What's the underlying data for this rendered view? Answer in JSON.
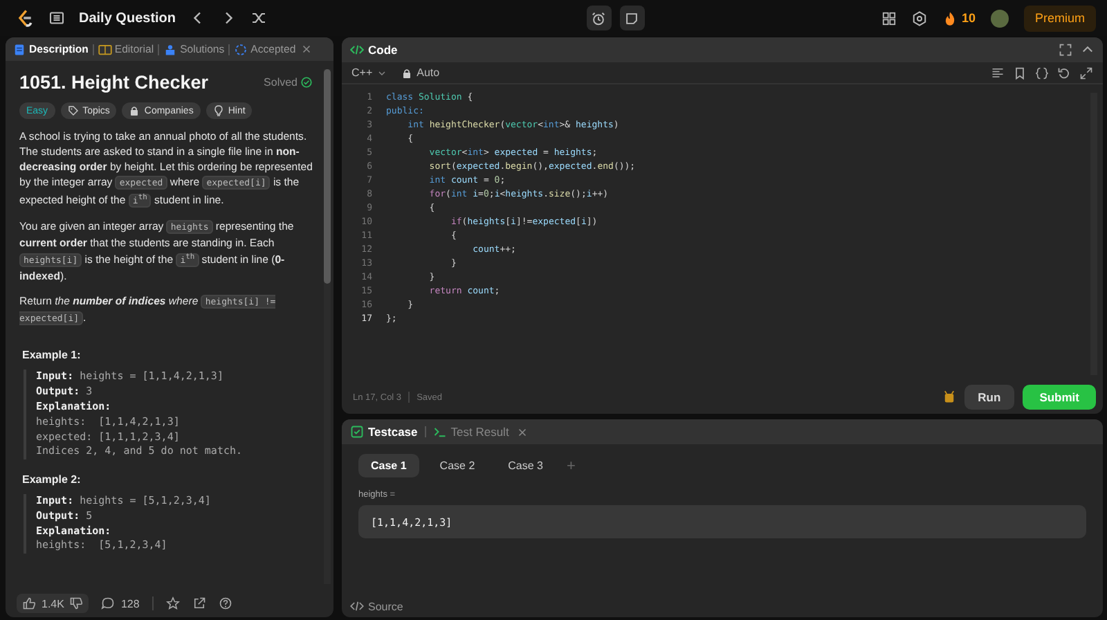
{
  "top_bar": {
    "title": "Daily Question",
    "streak": "10",
    "premium": "Premium"
  },
  "description_panel": {
    "tabs": [
      {
        "label": "Description",
        "selected": true,
        "closable": false
      },
      {
        "label": "Editorial",
        "selected": false,
        "closable": false
      },
      {
        "label": "Solutions",
        "selected": false,
        "closable": false
      },
      {
        "label": "Accepted",
        "selected": false,
        "closable": true
      }
    ],
    "title": "1051. Height Checker",
    "status": "Solved",
    "solved": true,
    "tags": [
      {
        "label": "Easy",
        "kind": "difficulty"
      },
      {
        "label": "Topics",
        "kind": "topics"
      },
      {
        "label": "Companies",
        "kind": "companies"
      },
      {
        "label": "Hint",
        "kind": "hint"
      }
    ],
    "paragraphs": [
      [
        {
          "kind": "text",
          "text": "A school is trying to take an annual photo of all the students. The students are asked to stand in a single file line in **non-decreasing order** by height. Let this ordering be represented by the integer array "
        },
        {
          "kind": "code",
          "text": "expected"
        },
        {
          "kind": "text",
          "text": " where "
        },
        {
          "kind": "code",
          "text": "expected[i]"
        },
        {
          "kind": "text",
          "text": " is the expected height of the "
        },
        {
          "kind": "code",
          "text": "i$^{th}$"
        },
        {
          "kind": "text",
          "text": " student in line."
        }
      ],
      [
        {
          "kind": "text",
          "text": "You are given an integer array "
        },
        {
          "kind": "code",
          "text": "heights"
        },
        {
          "kind": "text",
          "text": " representing the **current order** that the students are standing in. Each "
        },
        {
          "kind": "code",
          "text": "heights[i]"
        },
        {
          "kind": "text",
          "text": " is the height of the "
        },
        {
          "kind": "code",
          "text": "i$^{th}$"
        },
        {
          "kind": "text",
          "text": " student in line (**0-indexed**)."
        }
      ],
      [
        {
          "kind": "text",
          "text": "Return *the* "
        },
        {
          "kind": "strong_emphasis",
          "text": "number of indices"
        },
        {
          "kind": "text",
          "text": " *where* "
        },
        {
          "kind": "code",
          "text": "heights[i] != expected[i]"
        },
        {
          "kind": "text",
          "text": "."
        }
      ]
    ],
    "examples": [
      {
        "title": "Example 1:",
        "lines": [
          "**Input:** heights = [1,1,4,2,1,3]",
          "**Output:** 3",
          "**Explanation:**",
          "heights:  [1,1,4,2,1,3]",
          "expected: [1,1,1,2,3,4]",
          "Indices 2, 4, and 5 do not match."
        ]
      },
      {
        "title": "Example 2:",
        "lines": [
          "**Input:** heights = [5,1,2,3,4]",
          "**Output:** 5",
          "**Explanation:**",
          "heights:  [5,1,2,3,4]"
        ]
      }
    ],
    "footer": {
      "likes": "1.4K",
      "comments": "128"
    }
  },
  "code_panel": {
    "title": "Code",
    "language": "C++",
    "mode": "Auto",
    "lines": [
      {
        "number": "1",
        "tokens": [
          {
            "text": "class ",
            "kind": "keyword"
          },
          {
            "text": "Solution",
            "kind": "type"
          },
          {
            "text": " {",
            "kind": "plain"
          }
        ]
      },
      {
        "number": "2",
        "tokens": [
          {
            "text": "public:",
            "kind": "keyword"
          }
        ]
      },
      {
        "number": "3",
        "tokens": [
          {
            "text": "    int ",
            "kind": "keyword"
          },
          {
            "text": "heightChecker",
            "kind": "function"
          },
          {
            "text": "(",
            "kind": "plain"
          },
          {
            "text": "vector",
            "kind": "type"
          },
          {
            "text": "<",
            "kind": "plain"
          },
          {
            "text": "int",
            "kind": "keyword"
          },
          {
            "text": ">& ",
            "kind": "plain"
          },
          {
            "text": "heights",
            "kind": "variable"
          },
          {
            "text": ")",
            "kind": "plain"
          }
        ]
      },
      {
        "number": "4",
        "tokens": [
          {
            "text": "    {",
            "kind": "plain"
          }
        ]
      },
      {
        "number": "5",
        "tokens": [
          {
            "text": "        vector",
            "kind": "type"
          },
          {
            "text": "<",
            "kind": "plain"
          },
          {
            "text": "int",
            "kind": "keyword"
          },
          {
            "text": "> ",
            "kind": "plain"
          },
          {
            "text": "expected",
            "kind": "variable"
          },
          {
            "text": " = ",
            "kind": "plain"
          },
          {
            "text": "heights",
            "kind": "variable"
          },
          {
            "text": ";",
            "kind": "plain"
          }
        ]
      },
      {
        "number": "6",
        "tokens": [
          {
            "text": "        sort",
            "kind": "function"
          },
          {
            "text": "(",
            "kind": "plain"
          },
          {
            "text": "expected",
            "kind": "variable"
          },
          {
            "text": ".",
            "kind": "plain"
          },
          {
            "text": "begin",
            "kind": "function"
          },
          {
            "text": "(),",
            "kind": "plain"
          },
          {
            "text": "expected",
            "kind": "variable"
          },
          {
            "text": ".",
            "kind": "plain"
          },
          {
            "text": "end",
            "kind": "function"
          },
          {
            "text": "());",
            "kind": "plain"
          }
        ]
      },
      {
        "number": "7",
        "tokens": [
          {
            "text": "        int ",
            "kind": "keyword"
          },
          {
            "text": "count",
            "kind": "variable"
          },
          {
            "text": " = ",
            "kind": "plain"
          },
          {
            "text": "0",
            "kind": "number"
          },
          {
            "text": ";",
            "kind": "plain"
          }
        ]
      },
      {
        "number": "8",
        "tokens": [
          {
            "text": "        for",
            "kind": "control"
          },
          {
            "text": "(",
            "kind": "plain"
          },
          {
            "text": "int ",
            "kind": "keyword"
          },
          {
            "text": "i",
            "kind": "variable"
          },
          {
            "text": "=",
            "kind": "plain"
          },
          {
            "text": "0",
            "kind": "number"
          },
          {
            "text": ";",
            "kind": "plain"
          },
          {
            "text": "i",
            "kind": "variable"
          },
          {
            "text": "<",
            "kind": "plain"
          },
          {
            "text": "heights",
            "kind": "variable"
          },
          {
            "text": ".",
            "kind": "plain"
          },
          {
            "text": "size",
            "kind": "function"
          },
          {
            "text": "();",
            "kind": "plain"
          },
          {
            "text": "i",
            "kind": "variable"
          },
          {
            "text": "++)",
            "kind": "plain"
          }
        ]
      },
      {
        "number": "9",
        "tokens": [
          {
            "text": "        {",
            "kind": "plain"
          }
        ]
      },
      {
        "number": "10",
        "tokens": [
          {
            "text": "            if",
            "kind": "control"
          },
          {
            "text": "(",
            "kind": "plain"
          },
          {
            "text": "heights",
            "kind": "variable"
          },
          {
            "text": "[",
            "kind": "plain"
          },
          {
            "text": "i",
            "kind": "variable"
          },
          {
            "text": "]!=",
            "kind": "plain"
          },
          {
            "text": "expected",
            "kind": "variable"
          },
          {
            "text": "[",
            "kind": "plain"
          },
          {
            "text": "i",
            "kind": "variable"
          },
          {
            "text": "])",
            "kind": "plain"
          }
        ]
      },
      {
        "number": "11",
        "tokens": [
          {
            "text": "            {",
            "kind": "plain"
          }
        ]
      },
      {
        "number": "12",
        "tokens": [
          {
            "text": "                count",
            "kind": "variable"
          },
          {
            "text": "++;",
            "kind": "plain"
          }
        ]
      },
      {
        "number": "13",
        "tokens": [
          {
            "text": "            }",
            "kind": "plain"
          }
        ]
      },
      {
        "number": "14",
        "tokens": [
          {
            "text": "        }",
            "kind": "plain"
          }
        ]
      },
      {
        "number": "15",
        "tokens": [
          {
            "text": "        return ",
            "kind": "control"
          },
          {
            "text": "count",
            "kind": "variable"
          },
          {
            "text": ";",
            "kind": "plain"
          }
        ]
      },
      {
        "number": "16",
        "tokens": [
          {
            "text": "    }",
            "kind": "plain"
          }
        ]
      },
      {
        "number": "17",
        "tokens": [
          {
            "text": "};",
            "kind": "plain"
          }
        ]
      }
    ],
    "cursor": "Ln 17, Col 3",
    "save_state": "Saved",
    "run": "Run",
    "submit": "Submit"
  },
  "testcase_panel": {
    "tabs": [
      {
        "label": "Testcase",
        "selected": true,
        "closable": false
      },
      {
        "label": "Test Result",
        "selected": false,
        "closable": true
      }
    ],
    "cases": [
      {
        "label": "Case 1",
        "selected": true
      },
      {
        "label": "Case 2",
        "selected": false
      },
      {
        "label": "Case 3",
        "selected": false
      }
    ],
    "add": "+",
    "input_label": "heights =",
    "input_value": "[1,1,4,2,1,3]",
    "source": "Source"
  }
}
